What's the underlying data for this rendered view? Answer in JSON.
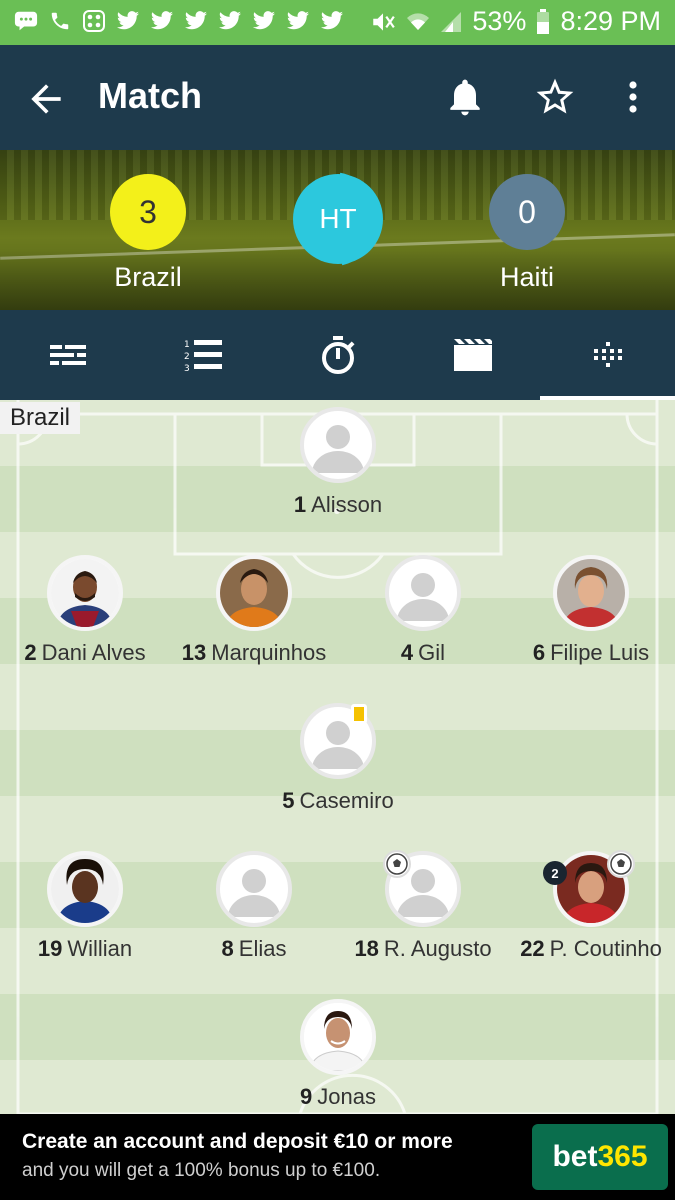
{
  "status_bar": {
    "battery": "53%",
    "time": "8:29 PM",
    "notification_icons": [
      "messages-icon",
      "phone-icon",
      "app-icon",
      "twitter-icon",
      "twitter-icon",
      "twitter-icon",
      "twitter-icon",
      "twitter-icon",
      "twitter-icon",
      "twitter-icon"
    ],
    "right_icons": [
      "mute-icon",
      "wifi-icon",
      "signal-icon",
      "battery-icon"
    ]
  },
  "app_bar": {
    "title": "Match",
    "actions": [
      "bell-icon",
      "star-icon",
      "more-icon"
    ]
  },
  "match": {
    "home": {
      "name": "Brazil",
      "score": "3",
      "color": "#f3f01a"
    },
    "away": {
      "name": "Haiti",
      "score": "0",
      "color": "#5f7f96"
    },
    "status": "HT",
    "status_color": "#2cc8dd"
  },
  "tabs": [
    {
      "icon": "summary-icon",
      "selected": false
    },
    {
      "icon": "ranked-list-icon",
      "selected": false
    },
    {
      "icon": "stopwatch-icon",
      "selected": false
    },
    {
      "icon": "video-icon",
      "selected": false
    },
    {
      "icon": "lineup-icon",
      "selected": true
    }
  ],
  "lineup": {
    "team": "Brazil",
    "players": [
      {
        "number": "1",
        "name": "Alisson",
        "photo": false
      },
      {
        "number": "2",
        "name": "Dani Alves",
        "photo": true
      },
      {
        "number": "13",
        "name": "Marquinhos",
        "photo": true
      },
      {
        "number": "4",
        "name": "Gil",
        "photo": false
      },
      {
        "number": "6",
        "name": "Filipe Luis",
        "photo": true
      },
      {
        "number": "5",
        "name": "Casemiro",
        "photo": false,
        "yellow_card": true
      },
      {
        "number": "19",
        "name": "Willian",
        "photo": true
      },
      {
        "number": "8",
        "name": "Elias",
        "photo": false
      },
      {
        "number": "18",
        "name": "R. Augusto",
        "photo": false,
        "goals": 1
      },
      {
        "number": "22",
        "name": "P. Coutinho",
        "photo": true,
        "goals": 2,
        "goal_badge": "2"
      },
      {
        "number": "9",
        "name": "Jonas",
        "photo": true
      }
    ]
  },
  "ad": {
    "headline": "Create an account and deposit €10 or more",
    "subline": "and you will get a 100% bonus up to €100.",
    "logo_main": "bet",
    "logo_accent": "365",
    "logo_color": "#0a6e4d",
    "accent_color": "#ffe600"
  }
}
